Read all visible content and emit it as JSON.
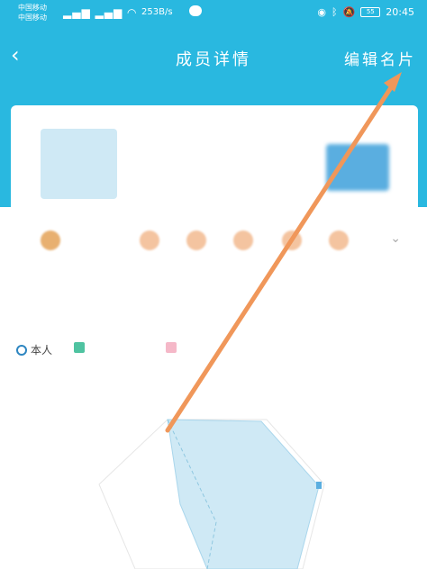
{
  "status_bar": {
    "carrier1": "中国移动",
    "carrier2": "中国移动",
    "speed": "253B/s",
    "battery": "55",
    "time": "20:45"
  },
  "header": {
    "back_icon": "chevron-left-icon",
    "title": "成员详情",
    "edit_label": "编辑名片"
  },
  "profile": {
    "name": "",
    "subtitle": ""
  },
  "section": {
    "title": "",
    "right_text": ""
  },
  "legend": {
    "self_label": "本人",
    "second_label": "",
    "third_label": ""
  },
  "colors": {
    "header_bg": "#29b8e0",
    "radar_fill": "#cfe9f5",
    "arrow": "#f0975a"
  }
}
